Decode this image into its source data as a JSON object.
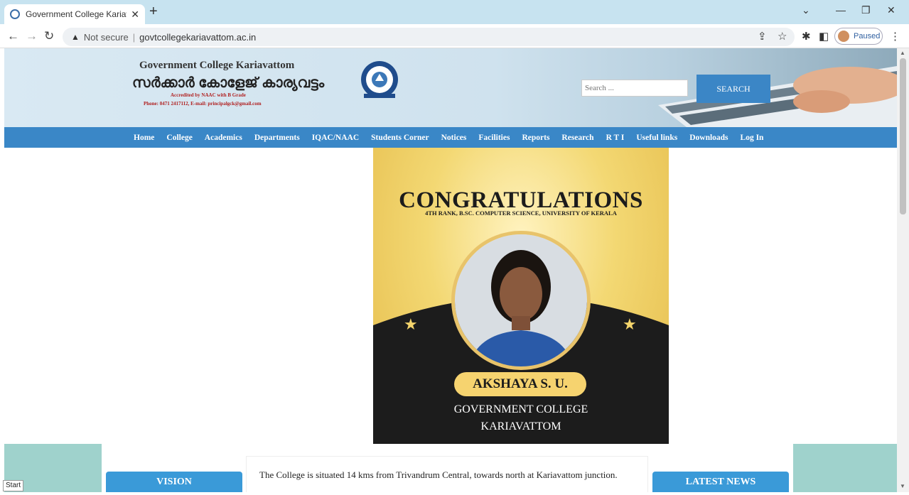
{
  "browser": {
    "tab_title": "Government College Kariavattom",
    "tab_close": "✕",
    "new_tab": "+",
    "address_warning": "Not secure",
    "url": "govtcollegekariavattom.ac.in",
    "profile_status": "Paused"
  },
  "header": {
    "college_name": "Government College Kariavattom",
    "college_name_malayalam": "സർക്കാർ കോളേജ് കാര്യവട്ടം",
    "accreditation": "Accredited by NAAC with B Grade",
    "contact": "Phone: 0471 2417112, E-mail: principalgck@gmail.com",
    "search_placeholder": "Search ...",
    "search_button": "SEARCH"
  },
  "nav": {
    "items": [
      "Home",
      "College",
      "Academics",
      "Departments",
      "IQAC/NAAC",
      "Students Corner",
      "Notices",
      "Facilities",
      "Reports",
      "Research",
      "R T I",
      "Useful links",
      "Downloads",
      "Log In"
    ]
  },
  "banner": {
    "headline": "CONGRATULATIONS",
    "subheadline": "4TH RANK, B.SC. COMPUTER SCIENCE, UNIVERSITY OF KERALA",
    "student_name": "AKSHAYA S. U.",
    "college_line1": "GOVERNMENT COLLEGE",
    "college_line2": "KARIAVATTOM"
  },
  "sections": {
    "vision_title": "VISION",
    "about_text": "The College is situated 14 kms from Trivandrum Central, towards north at Kariavattom junction.",
    "news_title": "LATEST NEWS"
  },
  "status": {
    "start_label": "Start"
  },
  "colors": {
    "nav_bar": "#3a87c7",
    "search_button": "#3b86c6",
    "section_header": "#3a9ad8",
    "banner_gold": "#f3d873",
    "banner_dark": "#1c1c1c",
    "tab_strip": "#c7e3f0"
  }
}
